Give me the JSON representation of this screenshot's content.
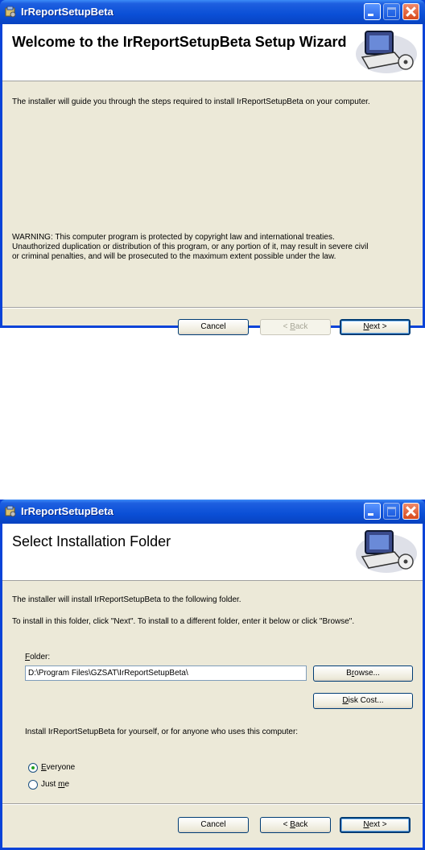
{
  "window_title": "IrReportSetupBeta",
  "welcome": {
    "banner_title": "Welcome to the IrReportSetupBeta Setup Wizard",
    "intro": "The installer will guide you through the steps required to install IrReportSetupBeta on your computer.",
    "warning_1": "WARNING: This computer program is protected by copyright law and international treaties.",
    "warning_2": "Unauthorized duplication or distribution of this program, or any portion of it, may result in severe civil",
    "warning_3": "or criminal penalties, and will be prosecuted to the maximum extent possible under the law.",
    "cancel": "Cancel",
    "back_pre": "< ",
    "back_key": "B",
    "back_post": "ack",
    "next_key": "N",
    "next_post": "ext >",
    "back_enabled": false
  },
  "folder": {
    "banner_title": "Select Installation Folder",
    "line_1": "The installer will install IrReportSetupBeta to the following folder.",
    "line_2": "To install in this folder, click \"Next\". To install to a different folder, enter it below or click \"Browse\".",
    "folder_label_key": "F",
    "folder_label_post": "older:",
    "folder_value": "D:\\Program Files\\GZSAT\\IrReportSetupBeta\\",
    "browse_pre": "B",
    "browse_key": "r",
    "browse_post": "owse...",
    "disk_key": "D",
    "disk_post": "isk Cost...",
    "install_for": "Install IrReportSetupBeta for yourself, or for anyone who uses this computer:",
    "everyone_key": "E",
    "everyone_post": "veryone",
    "justme_pre": "Just ",
    "justme_key": "m",
    "justme_post": "e",
    "selected": "Everyone",
    "cancel": "Cancel",
    "back_pre": "< ",
    "back_key": "B",
    "back_post": "ack",
    "next_key": "N",
    "next_post": "ext >"
  }
}
